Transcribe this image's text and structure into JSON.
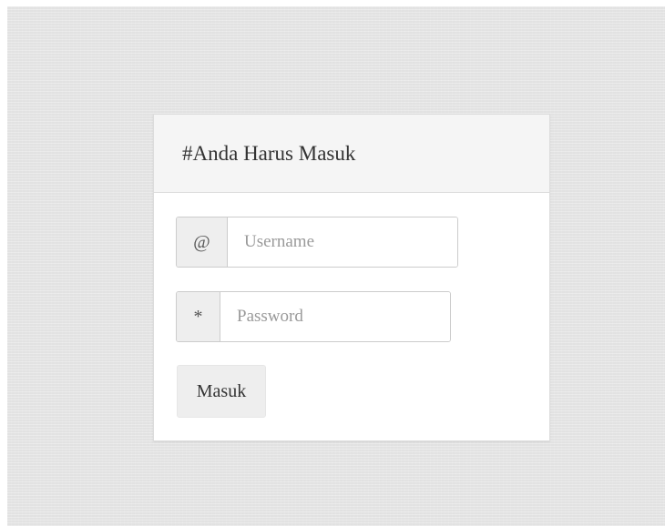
{
  "login": {
    "title": "#Anda Harus Masuk",
    "username": {
      "addon": "@",
      "placeholder": "Username",
      "value": ""
    },
    "password": {
      "addon": "*",
      "placeholder": "Password",
      "value": ""
    },
    "submit_label": "Masuk"
  },
  "colors": {
    "page_background": "#e6e6e6",
    "card_background": "#ffffff",
    "header_background": "#f5f5f5",
    "addon_background": "#eeeeee",
    "button_background": "#eeeeee",
    "border": "#cccccc"
  }
}
